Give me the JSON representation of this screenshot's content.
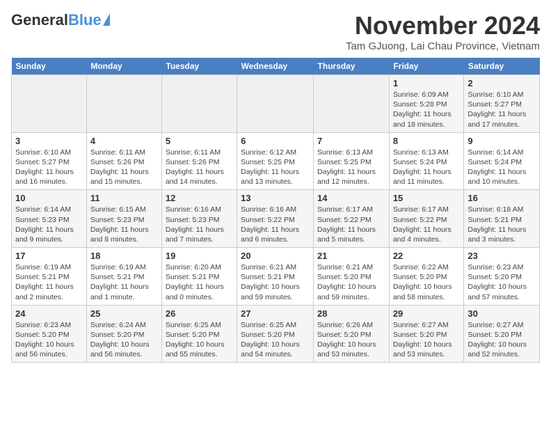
{
  "header": {
    "logo": {
      "general": "General",
      "blue": "Blue"
    },
    "title": "November 2024",
    "location": "Tam GJuong, Lai Chau Province, Vietnam"
  },
  "calendar": {
    "days_of_week": [
      "Sunday",
      "Monday",
      "Tuesday",
      "Wednesday",
      "Thursday",
      "Friday",
      "Saturday"
    ],
    "weeks": [
      [
        {
          "day": "",
          "info": ""
        },
        {
          "day": "",
          "info": ""
        },
        {
          "day": "",
          "info": ""
        },
        {
          "day": "",
          "info": ""
        },
        {
          "day": "",
          "info": ""
        },
        {
          "day": "1",
          "info": "Sunrise: 6:09 AM\nSunset: 5:28 PM\nDaylight: 11 hours and 18 minutes."
        },
        {
          "day": "2",
          "info": "Sunrise: 6:10 AM\nSunset: 5:27 PM\nDaylight: 11 hours and 17 minutes."
        }
      ],
      [
        {
          "day": "3",
          "info": "Sunrise: 6:10 AM\nSunset: 5:27 PM\nDaylight: 11 hours and 16 minutes."
        },
        {
          "day": "4",
          "info": "Sunrise: 6:11 AM\nSunset: 5:26 PM\nDaylight: 11 hours and 15 minutes."
        },
        {
          "day": "5",
          "info": "Sunrise: 6:11 AM\nSunset: 5:26 PM\nDaylight: 11 hours and 14 minutes."
        },
        {
          "day": "6",
          "info": "Sunrise: 6:12 AM\nSunset: 5:25 PM\nDaylight: 11 hours and 13 minutes."
        },
        {
          "day": "7",
          "info": "Sunrise: 6:13 AM\nSunset: 5:25 PM\nDaylight: 11 hours and 12 minutes."
        },
        {
          "day": "8",
          "info": "Sunrise: 6:13 AM\nSunset: 5:24 PM\nDaylight: 11 hours and 11 minutes."
        },
        {
          "day": "9",
          "info": "Sunrise: 6:14 AM\nSunset: 5:24 PM\nDaylight: 11 hours and 10 minutes."
        }
      ],
      [
        {
          "day": "10",
          "info": "Sunrise: 6:14 AM\nSunset: 5:23 PM\nDaylight: 11 hours and 9 minutes."
        },
        {
          "day": "11",
          "info": "Sunrise: 6:15 AM\nSunset: 5:23 PM\nDaylight: 11 hours and 8 minutes."
        },
        {
          "day": "12",
          "info": "Sunrise: 6:16 AM\nSunset: 5:23 PM\nDaylight: 11 hours and 7 minutes."
        },
        {
          "day": "13",
          "info": "Sunrise: 6:16 AM\nSunset: 5:22 PM\nDaylight: 11 hours and 6 minutes."
        },
        {
          "day": "14",
          "info": "Sunrise: 6:17 AM\nSunset: 5:22 PM\nDaylight: 11 hours and 5 minutes."
        },
        {
          "day": "15",
          "info": "Sunrise: 6:17 AM\nSunset: 5:22 PM\nDaylight: 11 hours and 4 minutes."
        },
        {
          "day": "16",
          "info": "Sunrise: 6:18 AM\nSunset: 5:21 PM\nDaylight: 11 hours and 3 minutes."
        }
      ],
      [
        {
          "day": "17",
          "info": "Sunrise: 6:19 AM\nSunset: 5:21 PM\nDaylight: 11 hours and 2 minutes."
        },
        {
          "day": "18",
          "info": "Sunrise: 6:19 AM\nSunset: 5:21 PM\nDaylight: 11 hours and 1 minute."
        },
        {
          "day": "19",
          "info": "Sunrise: 6:20 AM\nSunset: 5:21 PM\nDaylight: 11 hours and 0 minutes."
        },
        {
          "day": "20",
          "info": "Sunrise: 6:21 AM\nSunset: 5:21 PM\nDaylight: 10 hours and 59 minutes."
        },
        {
          "day": "21",
          "info": "Sunrise: 6:21 AM\nSunset: 5:20 PM\nDaylight: 10 hours and 59 minutes."
        },
        {
          "day": "22",
          "info": "Sunrise: 6:22 AM\nSunset: 5:20 PM\nDaylight: 10 hours and 58 minutes."
        },
        {
          "day": "23",
          "info": "Sunrise: 6:23 AM\nSunset: 5:20 PM\nDaylight: 10 hours and 57 minutes."
        }
      ],
      [
        {
          "day": "24",
          "info": "Sunrise: 6:23 AM\nSunset: 5:20 PM\nDaylight: 10 hours and 56 minutes."
        },
        {
          "day": "25",
          "info": "Sunrise: 6:24 AM\nSunset: 5:20 PM\nDaylight: 10 hours and 56 minutes."
        },
        {
          "day": "26",
          "info": "Sunrise: 6:25 AM\nSunset: 5:20 PM\nDaylight: 10 hours and 55 minutes."
        },
        {
          "day": "27",
          "info": "Sunrise: 6:25 AM\nSunset: 5:20 PM\nDaylight: 10 hours and 54 minutes."
        },
        {
          "day": "28",
          "info": "Sunrise: 6:26 AM\nSunset: 5:20 PM\nDaylight: 10 hours and 53 minutes."
        },
        {
          "day": "29",
          "info": "Sunrise: 6:27 AM\nSunset: 5:20 PM\nDaylight: 10 hours and 53 minutes."
        },
        {
          "day": "30",
          "info": "Sunrise: 6:27 AM\nSunset: 5:20 PM\nDaylight: 10 hours and 52 minutes."
        }
      ]
    ]
  }
}
